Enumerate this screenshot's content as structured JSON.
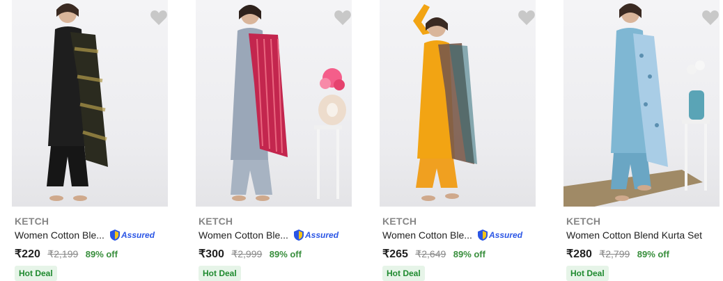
{
  "products": [
    {
      "brand": "KETCH",
      "title": "Women Cotton Ble...",
      "assured": true,
      "assured_label": "Assured",
      "price": "₹220",
      "mrp": "₹2,199",
      "discount": "89% off",
      "deal": "Hot Deal",
      "outfit_color": "#1e1e1e",
      "dupatta_color": "#2b2b1f"
    },
    {
      "brand": "KETCH",
      "title": "Women Cotton Ble...",
      "assured": true,
      "assured_label": "Assured",
      "price": "₹300",
      "mrp": "₹2,999",
      "discount": "89% off",
      "deal": "Hot Deal",
      "outfit_color": "#9aa7b8",
      "dupatta_color": "#c3264e"
    },
    {
      "brand": "KETCH",
      "title": "Women Cotton Ble...",
      "assured": true,
      "assured_label": "Assured",
      "price": "₹265",
      "mrp": "₹2,649",
      "discount": "89% off",
      "deal": "Hot Deal",
      "outfit_color": "#f2a413",
      "dupatta_color": "#7a5a4a"
    },
    {
      "brand": "KETCH",
      "title": "Women Cotton Blend Kurta Set",
      "assured": false,
      "price": "₹280",
      "mrp": "₹2,799",
      "discount": "89% off",
      "deal": "Hot Deal",
      "outfit_color": "#7fb7d3",
      "dupatta_color": "#a9cde6"
    }
  ],
  "colors": {
    "discount": "#388e3c",
    "assured": "#2a55e5",
    "deal_bg": "#e6f4e8"
  },
  "icons": {
    "wishlist": "heart-icon",
    "assured": "shield-icon"
  }
}
